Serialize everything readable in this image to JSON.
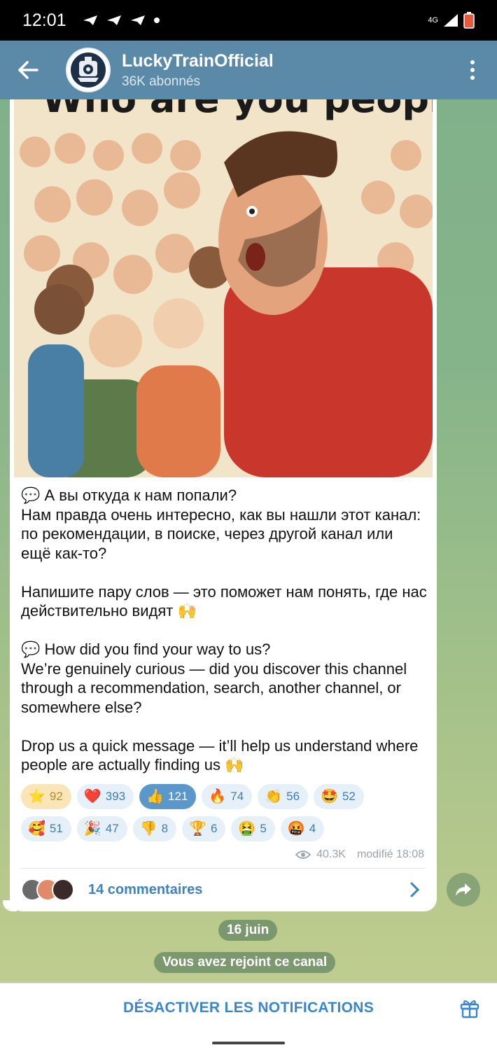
{
  "status_bar": {
    "time": "12:01",
    "network": "4G"
  },
  "header": {
    "channel_name": "LuckyTrainOfficial",
    "subscribers": "36K abonnés"
  },
  "post": {
    "image_caption": "Who are you people?",
    "text": "💬 А вы откуда к нам попали?\nНам правда очень интересно, как вы нашли этот канал: по рекомендации, в поиске, через другой канал или ещё как-то?\n\nНапишите пару слов — это поможет нам понять, где нас действительно видят 🙌\n\n💬 How did you find your way to us?\nWe’re genuinely curious — did you discover this channel through a recommendation, search, another channel, or somewhere else?\n\nDrop us a quick message — it’ll help us understand where people are actually finding us 🙌",
    "reactions_row1": [
      {
        "emoji": "⭐",
        "count": "92"
      },
      {
        "emoji": "❤️",
        "count": "393"
      },
      {
        "emoji": "👍",
        "count": "121"
      },
      {
        "emoji": "🔥",
        "count": "74"
      },
      {
        "emoji": "👏",
        "count": "56"
      },
      {
        "emoji": "🤩",
        "count": "52"
      }
    ],
    "reactions_row2": [
      {
        "emoji": "🥰",
        "count": "51"
      },
      {
        "emoji": "🎉",
        "count": "47"
      },
      {
        "emoji": "👎",
        "count": "8"
      },
      {
        "emoji": "🏆",
        "count": "6"
      },
      {
        "emoji": "🤮",
        "count": "5"
      },
      {
        "emoji": "🤬",
        "count": "4"
      }
    ],
    "views": "40.3K",
    "edited": "modifié 18:08",
    "comments_label": "14 commentaires"
  },
  "service": {
    "date": "16 juin",
    "joined": "Vous avez rejoint ce canal"
  },
  "bottom": {
    "mute_label": "DÉSACTIVER LES NOTIFICATIONS"
  },
  "colors": {
    "header": "#5b8aa9",
    "accent": "#3a86c8"
  }
}
